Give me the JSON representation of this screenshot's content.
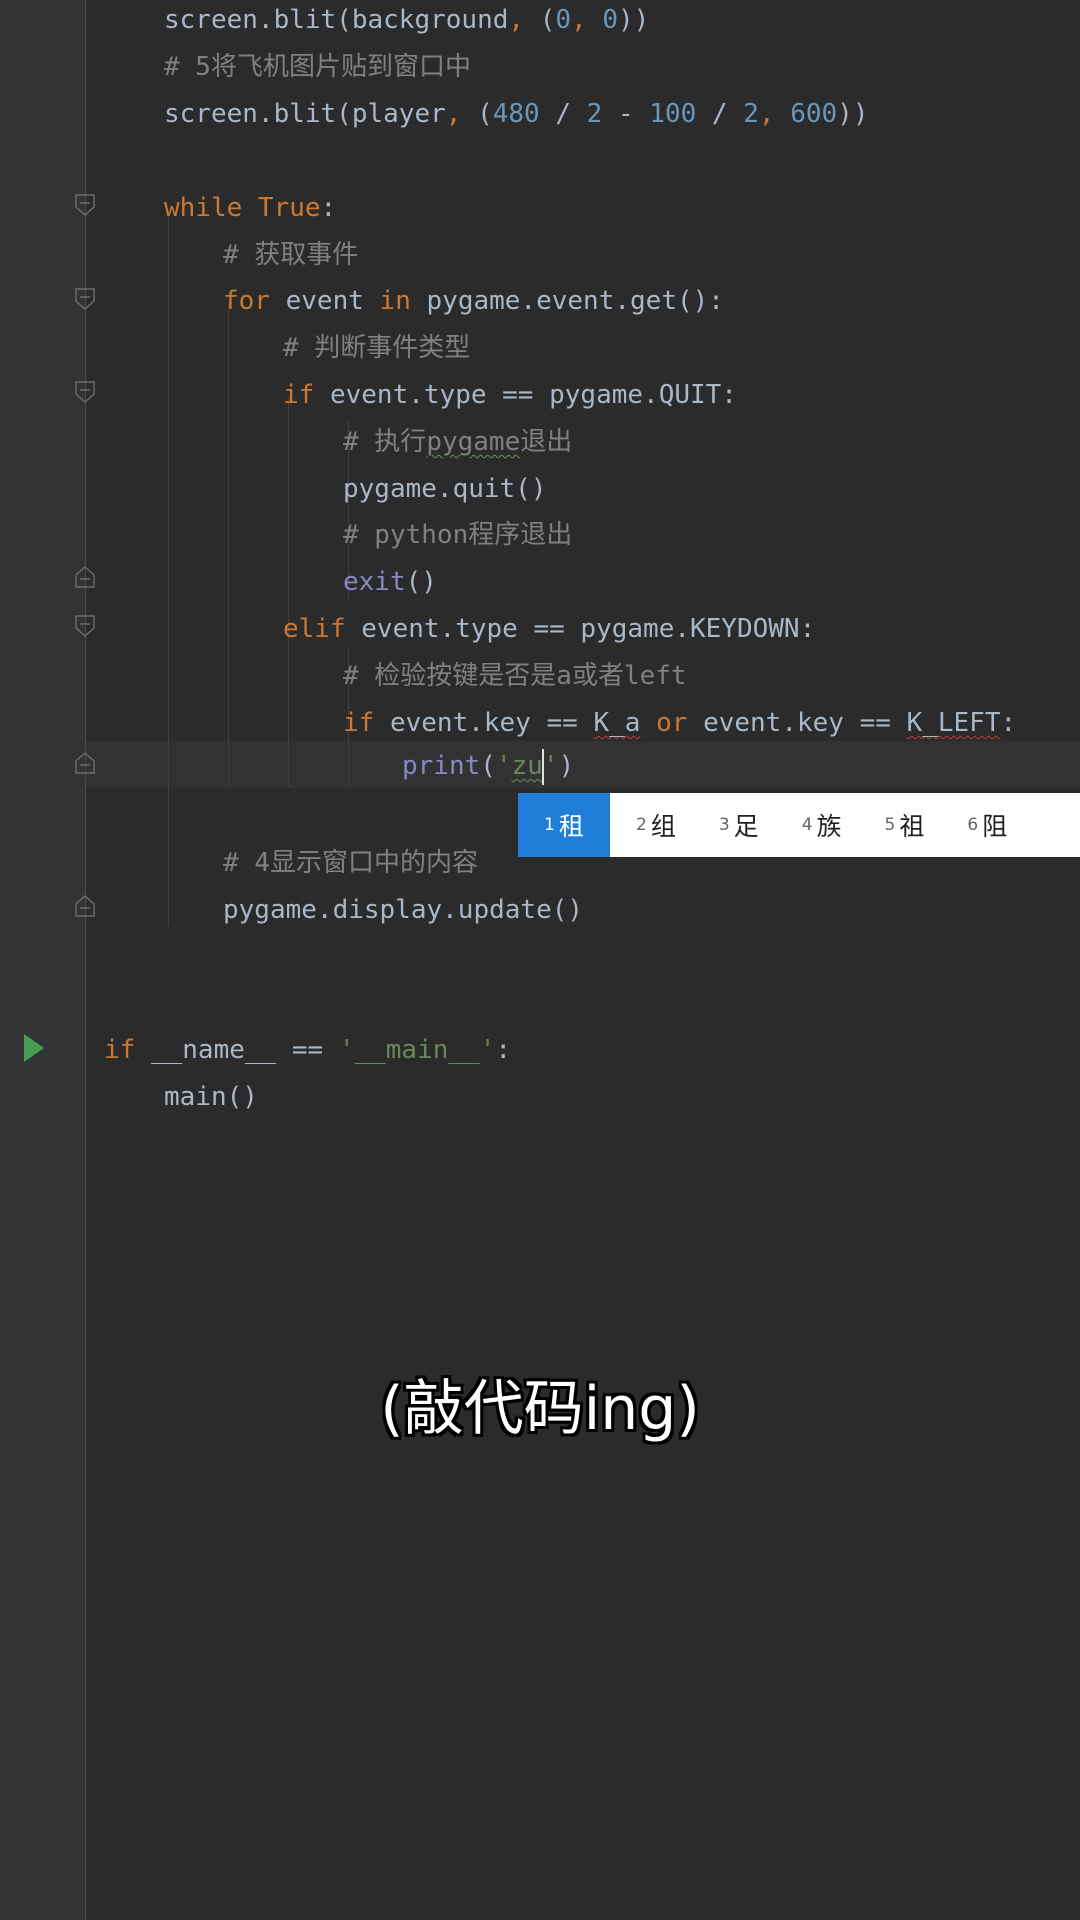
{
  "editor": {
    "lines": [
      {
        "parts": [
          [
            "fn",
            "screen.blit(background"
          ],
          [
            "kw",
            ", "
          ],
          [
            "fn",
            "("
          ],
          [
            "num",
            "0"
          ],
          [
            "kw",
            ", "
          ],
          [
            "num",
            "0"
          ],
          [
            "fn",
            "))"
          ]
        ]
      },
      {
        "parts": [
          [
            "cmt",
            "# 5将飞机图片贴到窗口中"
          ]
        ]
      },
      {
        "parts": [
          [
            "fn",
            "screen.blit(player"
          ],
          [
            "kw",
            ", "
          ],
          [
            "fn",
            "("
          ],
          [
            "num",
            "480"
          ],
          [
            "fn",
            " / "
          ],
          [
            "num",
            "2"
          ],
          [
            "fn",
            " - "
          ],
          [
            "num",
            "100"
          ],
          [
            "fn",
            " / "
          ],
          [
            "num",
            "2"
          ],
          [
            "kw",
            ", "
          ],
          [
            "num",
            "600"
          ],
          [
            "fn",
            "))"
          ]
        ]
      },
      {
        "parts": []
      },
      {
        "parts": [
          [
            "kw",
            "while "
          ],
          [
            "kw",
            "True"
          ],
          [
            "fn",
            ":"
          ]
        ]
      },
      {
        "parts": [
          [
            "cmt",
            "# 获取事件"
          ]
        ]
      },
      {
        "parts": [
          [
            "kw",
            "for "
          ],
          [
            "fn",
            "event "
          ],
          [
            "kw",
            "in "
          ],
          [
            "fn",
            "pygame.event.get():"
          ]
        ]
      },
      {
        "parts": [
          [
            "cmt",
            "# 判断事件类型"
          ]
        ]
      },
      {
        "parts": [
          [
            "kw",
            "if "
          ],
          [
            "fn",
            "event.type == pygame.QUIT:"
          ]
        ]
      },
      {
        "parts": [
          [
            "cmt",
            "# 执行"
          ],
          [
            "cmt-squig",
            "pygame"
          ],
          [
            "cmt",
            "退出"
          ]
        ]
      },
      {
        "parts": [
          [
            "fn",
            "pygame.quit()"
          ]
        ]
      },
      {
        "parts": [
          [
            "cmt",
            "# python程序退出"
          ]
        ]
      },
      {
        "parts": [
          [
            "builtin",
            "exit"
          ],
          [
            "fn",
            "()"
          ]
        ]
      },
      {
        "parts": [
          [
            "kw",
            "elif "
          ],
          [
            "fn",
            "event.type == pygame.KEYDOWN:"
          ]
        ]
      },
      {
        "parts": [
          [
            "cmt",
            "# 检验按键是否是a或者left"
          ]
        ]
      },
      {
        "parts": [
          [
            "kw",
            "if "
          ],
          [
            "fn",
            "event.key == "
          ],
          [
            "fn-squig",
            "K_a"
          ],
          [
            "fn",
            " "
          ],
          [
            "kw",
            "or "
          ],
          [
            "fn",
            "event.key == "
          ],
          [
            "fn-squig",
            "K_LEFT"
          ],
          [
            "fn",
            ":"
          ]
        ]
      },
      {
        "parts": [
          [
            "builtin",
            "print"
          ],
          [
            "fn",
            "("
          ],
          [
            "str",
            "'"
          ],
          [
            "str-squig",
            "zu"
          ],
          [
            "caret",
            ""
          ],
          [
            "str",
            "'"
          ],
          [
            "fn",
            ")"
          ]
        ]
      },
      {
        "parts": []
      },
      {
        "parts": [
          [
            "cmt",
            "# 4显示窗口中的内容"
          ]
        ]
      },
      {
        "parts": [
          [
            "fn",
            "pygame.display.update()"
          ]
        ]
      },
      {
        "parts": []
      },
      {
        "parts": []
      },
      {
        "parts": [
          [
            "kw",
            "if "
          ],
          [
            "fn",
            "__name__ == "
          ],
          [
            "str",
            "'__main__'"
          ],
          [
            "fn",
            ":"
          ]
        ]
      },
      {
        "parts": [
          [
            "fn",
            "main()"
          ]
        ]
      }
    ]
  },
  "ime": {
    "candidates": [
      {
        "n": "1",
        "text": "租"
      },
      {
        "n": "2",
        "text": "组"
      },
      {
        "n": "3",
        "text": "足"
      },
      {
        "n": "4",
        "text": "族"
      },
      {
        "n": "5",
        "text": "祖"
      },
      {
        "n": "6",
        "text": "阻"
      }
    ]
  },
  "subtitle": "(敲代码ing)"
}
